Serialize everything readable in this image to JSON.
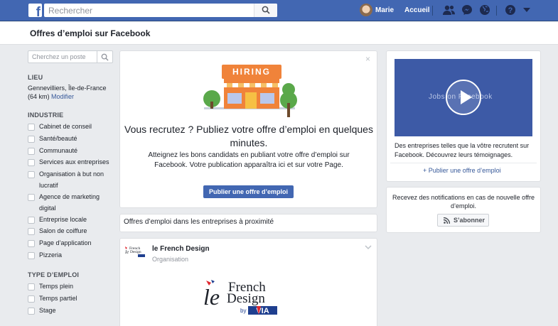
{
  "topbar": {
    "search_placeholder": "Rechercher",
    "user_name": "Marie",
    "home_label": "Accueil",
    "bg_color": "#4267b2"
  },
  "header": {
    "title": "Offres d’emploi sur Facebook"
  },
  "sidebar": {
    "search_placeholder": "Cherchez un poste",
    "location_heading": "LIEU",
    "location_text": "Gennevilliers, Île-de-France (64 km)",
    "location_modify": "Modifier",
    "industry_heading": "INDUSTRIE",
    "industries": [
      "Cabinet de conseil",
      "Santé/beauté",
      "Communauté",
      "Services aux entreprises",
      "Organisation à but non lucratif",
      "Agence de marketing digital",
      "Entreprise locale",
      "Salon de coiffure",
      "Page d’application",
      "Pizzeria"
    ],
    "jobtype_heading": "TYPE D’EMPLOI",
    "jobtypes": [
      "Temps plein",
      "Temps partiel",
      "Stage"
    ]
  },
  "promo": {
    "hiring_sign": "HIRING",
    "title": "Vous recrutez ? Publiez votre offre d’emploi en quelques minutes.",
    "text": "Atteignez les bons candidats en publiant votre offre d’emploi sur Facebook. Votre publication apparaîtra ici et sur votre Page.",
    "button": "Publier une offre d’emploi",
    "close": "×"
  },
  "nearby": {
    "title": "Offres d’emploi dans les entreprises à proximité"
  },
  "job": {
    "company": "le French Design",
    "type": "Organisation",
    "logo_line1": "French",
    "logo_line2": "Design",
    "logo_by": "by",
    "logo_via": "VIA"
  },
  "right": {
    "video_text": "Jobs on Facebook",
    "video_desc": "Des entreprises telles que la vôtre recrutent sur Facebook. Découvrez leurs témoignages.",
    "post_link": "+ Publier une offre d’emploi",
    "notif_text": "Recevez des notifications en cas de nouvelle offre d’emploi.",
    "subscribe": "S’abonner"
  },
  "colors": {
    "brand": "#4267b2",
    "link": "#365899",
    "background": "#e9ebee",
    "shop_orange": "#f0833a",
    "tree_green": "#5aa84a",
    "via_blue": "#1f3f8f",
    "via_red": "#e0262e"
  }
}
